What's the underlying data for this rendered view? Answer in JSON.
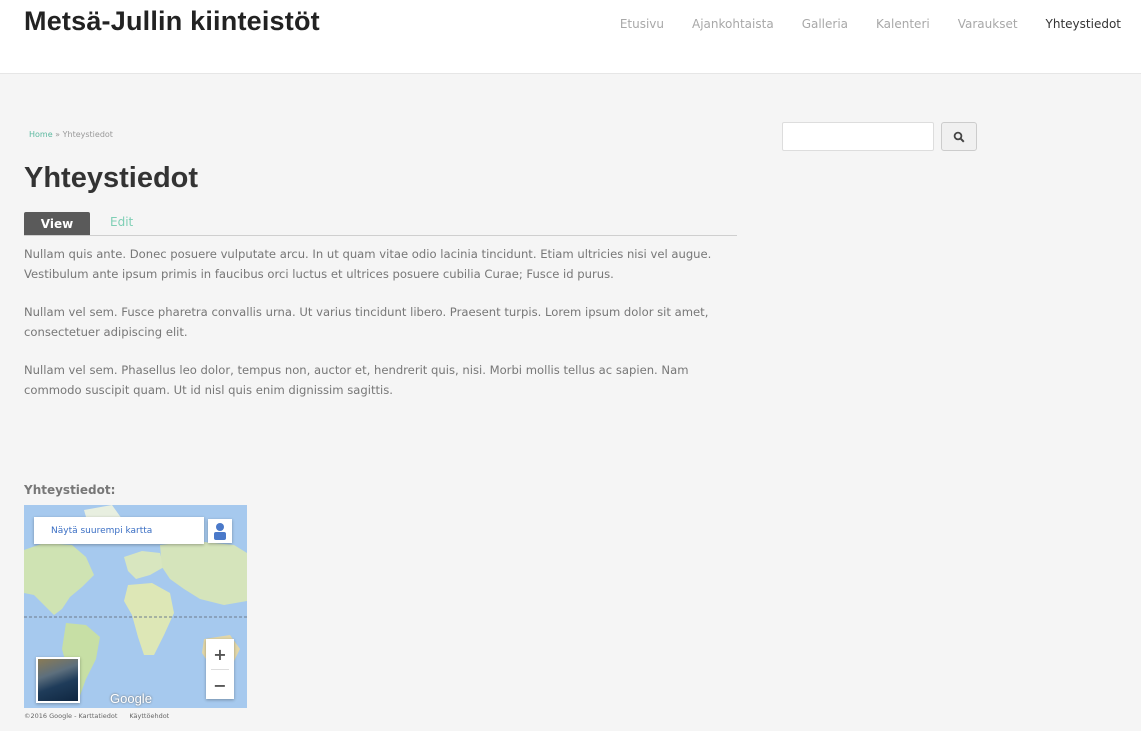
{
  "site": {
    "title": "Metsä-Jullin kiinteistöt"
  },
  "nav": {
    "items": [
      {
        "label": "Etusivu"
      },
      {
        "label": "Ajankohtaista"
      },
      {
        "label": "Galleria"
      },
      {
        "label": "Kalenteri"
      },
      {
        "label": "Varaukset"
      },
      {
        "label": "Yhteystiedot",
        "active": true
      }
    ]
  },
  "breadcrumb": {
    "home": "Home",
    "separator": "»",
    "current": "Yhteystiedot"
  },
  "page": {
    "title": "Yhteystiedot"
  },
  "tabs": {
    "view": "View",
    "edit": "Edit"
  },
  "content": {
    "paragraphs": [
      "Nullam quis ante. Donec posuere vulputate arcu. In ut quam vitae odio lacinia tincidunt. Etiam ultricies nisi vel augue. Vestibulum ante ipsum primis in faucibus orci luctus et ultrices posuere cubilia Curae; Fusce id purus.",
      "Nullam vel sem. Fusce pharetra convallis urna. Ut varius tincidunt libero. Praesent turpis. Lorem ipsum dolor sit amet, consectetuer adipiscing elit.",
      "Nullam vel sem. Phasellus leo dolor, tempus non, auctor et, hendrerit quis, nisi. Morbi mollis tellus ac sapien. Nam commodo suscipit quam. Ut id nisl quis enim dignissim sagittis."
    ],
    "contact_label": "Yhteystiedot:"
  },
  "map": {
    "larger_map_link": "Näytä suurempi kartta",
    "zoom_in": "+",
    "zoom_out": "−",
    "logo": "Google",
    "copyright": "©2016 Google - Karttatiedot",
    "terms": "Käyttöehdot"
  },
  "search": {
    "button_icon": "search-icon"
  },
  "colors": {
    "accent": "#5cb9a0",
    "header_bg": "#ffffff",
    "page_bg": "#f5f5f5",
    "tab_active_bg": "#5a5a5a"
  }
}
